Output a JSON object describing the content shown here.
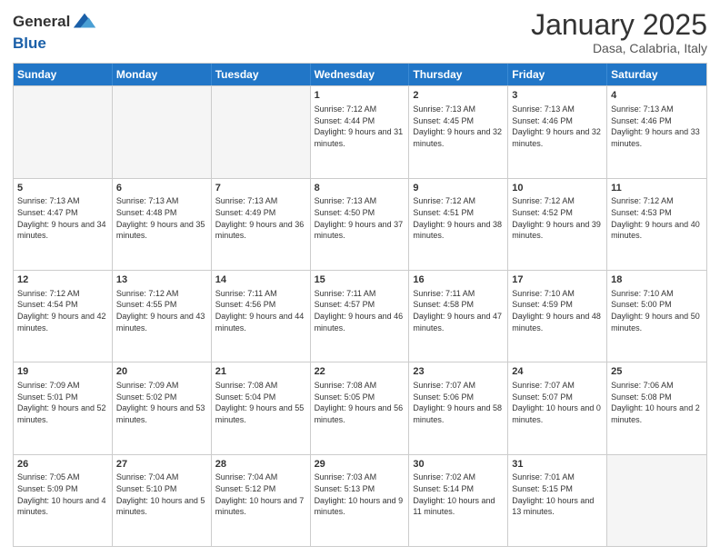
{
  "header": {
    "logo_line1": "General",
    "logo_line2": "Blue",
    "month": "January 2025",
    "location": "Dasa, Calabria, Italy"
  },
  "weekdays": [
    "Sunday",
    "Monday",
    "Tuesday",
    "Wednesday",
    "Thursday",
    "Friday",
    "Saturday"
  ],
  "rows": [
    [
      {
        "day": "",
        "info": "",
        "empty": true
      },
      {
        "day": "",
        "info": "",
        "empty": true
      },
      {
        "day": "",
        "info": "",
        "empty": true
      },
      {
        "day": "1",
        "info": "Sunrise: 7:12 AM\nSunset: 4:44 PM\nDaylight: 9 hours and 31 minutes.",
        "empty": false
      },
      {
        "day": "2",
        "info": "Sunrise: 7:13 AM\nSunset: 4:45 PM\nDaylight: 9 hours and 32 minutes.",
        "empty": false
      },
      {
        "day": "3",
        "info": "Sunrise: 7:13 AM\nSunset: 4:46 PM\nDaylight: 9 hours and 32 minutes.",
        "empty": false
      },
      {
        "day": "4",
        "info": "Sunrise: 7:13 AM\nSunset: 4:46 PM\nDaylight: 9 hours and 33 minutes.",
        "empty": false
      }
    ],
    [
      {
        "day": "5",
        "info": "Sunrise: 7:13 AM\nSunset: 4:47 PM\nDaylight: 9 hours and 34 minutes.",
        "empty": false
      },
      {
        "day": "6",
        "info": "Sunrise: 7:13 AM\nSunset: 4:48 PM\nDaylight: 9 hours and 35 minutes.",
        "empty": false
      },
      {
        "day": "7",
        "info": "Sunrise: 7:13 AM\nSunset: 4:49 PM\nDaylight: 9 hours and 36 minutes.",
        "empty": false
      },
      {
        "day": "8",
        "info": "Sunrise: 7:13 AM\nSunset: 4:50 PM\nDaylight: 9 hours and 37 minutes.",
        "empty": false
      },
      {
        "day": "9",
        "info": "Sunrise: 7:12 AM\nSunset: 4:51 PM\nDaylight: 9 hours and 38 minutes.",
        "empty": false
      },
      {
        "day": "10",
        "info": "Sunrise: 7:12 AM\nSunset: 4:52 PM\nDaylight: 9 hours and 39 minutes.",
        "empty": false
      },
      {
        "day": "11",
        "info": "Sunrise: 7:12 AM\nSunset: 4:53 PM\nDaylight: 9 hours and 40 minutes.",
        "empty": false
      }
    ],
    [
      {
        "day": "12",
        "info": "Sunrise: 7:12 AM\nSunset: 4:54 PM\nDaylight: 9 hours and 42 minutes.",
        "empty": false
      },
      {
        "day": "13",
        "info": "Sunrise: 7:12 AM\nSunset: 4:55 PM\nDaylight: 9 hours and 43 minutes.",
        "empty": false
      },
      {
        "day": "14",
        "info": "Sunrise: 7:11 AM\nSunset: 4:56 PM\nDaylight: 9 hours and 44 minutes.",
        "empty": false
      },
      {
        "day": "15",
        "info": "Sunrise: 7:11 AM\nSunset: 4:57 PM\nDaylight: 9 hours and 46 minutes.",
        "empty": false
      },
      {
        "day": "16",
        "info": "Sunrise: 7:11 AM\nSunset: 4:58 PM\nDaylight: 9 hours and 47 minutes.",
        "empty": false
      },
      {
        "day": "17",
        "info": "Sunrise: 7:10 AM\nSunset: 4:59 PM\nDaylight: 9 hours and 48 minutes.",
        "empty": false
      },
      {
        "day": "18",
        "info": "Sunrise: 7:10 AM\nSunset: 5:00 PM\nDaylight: 9 hours and 50 minutes.",
        "empty": false
      }
    ],
    [
      {
        "day": "19",
        "info": "Sunrise: 7:09 AM\nSunset: 5:01 PM\nDaylight: 9 hours and 52 minutes.",
        "empty": false
      },
      {
        "day": "20",
        "info": "Sunrise: 7:09 AM\nSunset: 5:02 PM\nDaylight: 9 hours and 53 minutes.",
        "empty": false
      },
      {
        "day": "21",
        "info": "Sunrise: 7:08 AM\nSunset: 5:04 PM\nDaylight: 9 hours and 55 minutes.",
        "empty": false
      },
      {
        "day": "22",
        "info": "Sunrise: 7:08 AM\nSunset: 5:05 PM\nDaylight: 9 hours and 56 minutes.",
        "empty": false
      },
      {
        "day": "23",
        "info": "Sunrise: 7:07 AM\nSunset: 5:06 PM\nDaylight: 9 hours and 58 minutes.",
        "empty": false
      },
      {
        "day": "24",
        "info": "Sunrise: 7:07 AM\nSunset: 5:07 PM\nDaylight: 10 hours and 0 minutes.",
        "empty": false
      },
      {
        "day": "25",
        "info": "Sunrise: 7:06 AM\nSunset: 5:08 PM\nDaylight: 10 hours and 2 minutes.",
        "empty": false
      }
    ],
    [
      {
        "day": "26",
        "info": "Sunrise: 7:05 AM\nSunset: 5:09 PM\nDaylight: 10 hours and 4 minutes.",
        "empty": false
      },
      {
        "day": "27",
        "info": "Sunrise: 7:04 AM\nSunset: 5:10 PM\nDaylight: 10 hours and 5 minutes.",
        "empty": false
      },
      {
        "day": "28",
        "info": "Sunrise: 7:04 AM\nSunset: 5:12 PM\nDaylight: 10 hours and 7 minutes.",
        "empty": false
      },
      {
        "day": "29",
        "info": "Sunrise: 7:03 AM\nSunset: 5:13 PM\nDaylight: 10 hours and 9 minutes.",
        "empty": false
      },
      {
        "day": "30",
        "info": "Sunrise: 7:02 AM\nSunset: 5:14 PM\nDaylight: 10 hours and 11 minutes.",
        "empty": false
      },
      {
        "day": "31",
        "info": "Sunrise: 7:01 AM\nSunset: 5:15 PM\nDaylight: 10 hours and 13 minutes.",
        "empty": false
      },
      {
        "day": "",
        "info": "",
        "empty": true
      }
    ]
  ]
}
